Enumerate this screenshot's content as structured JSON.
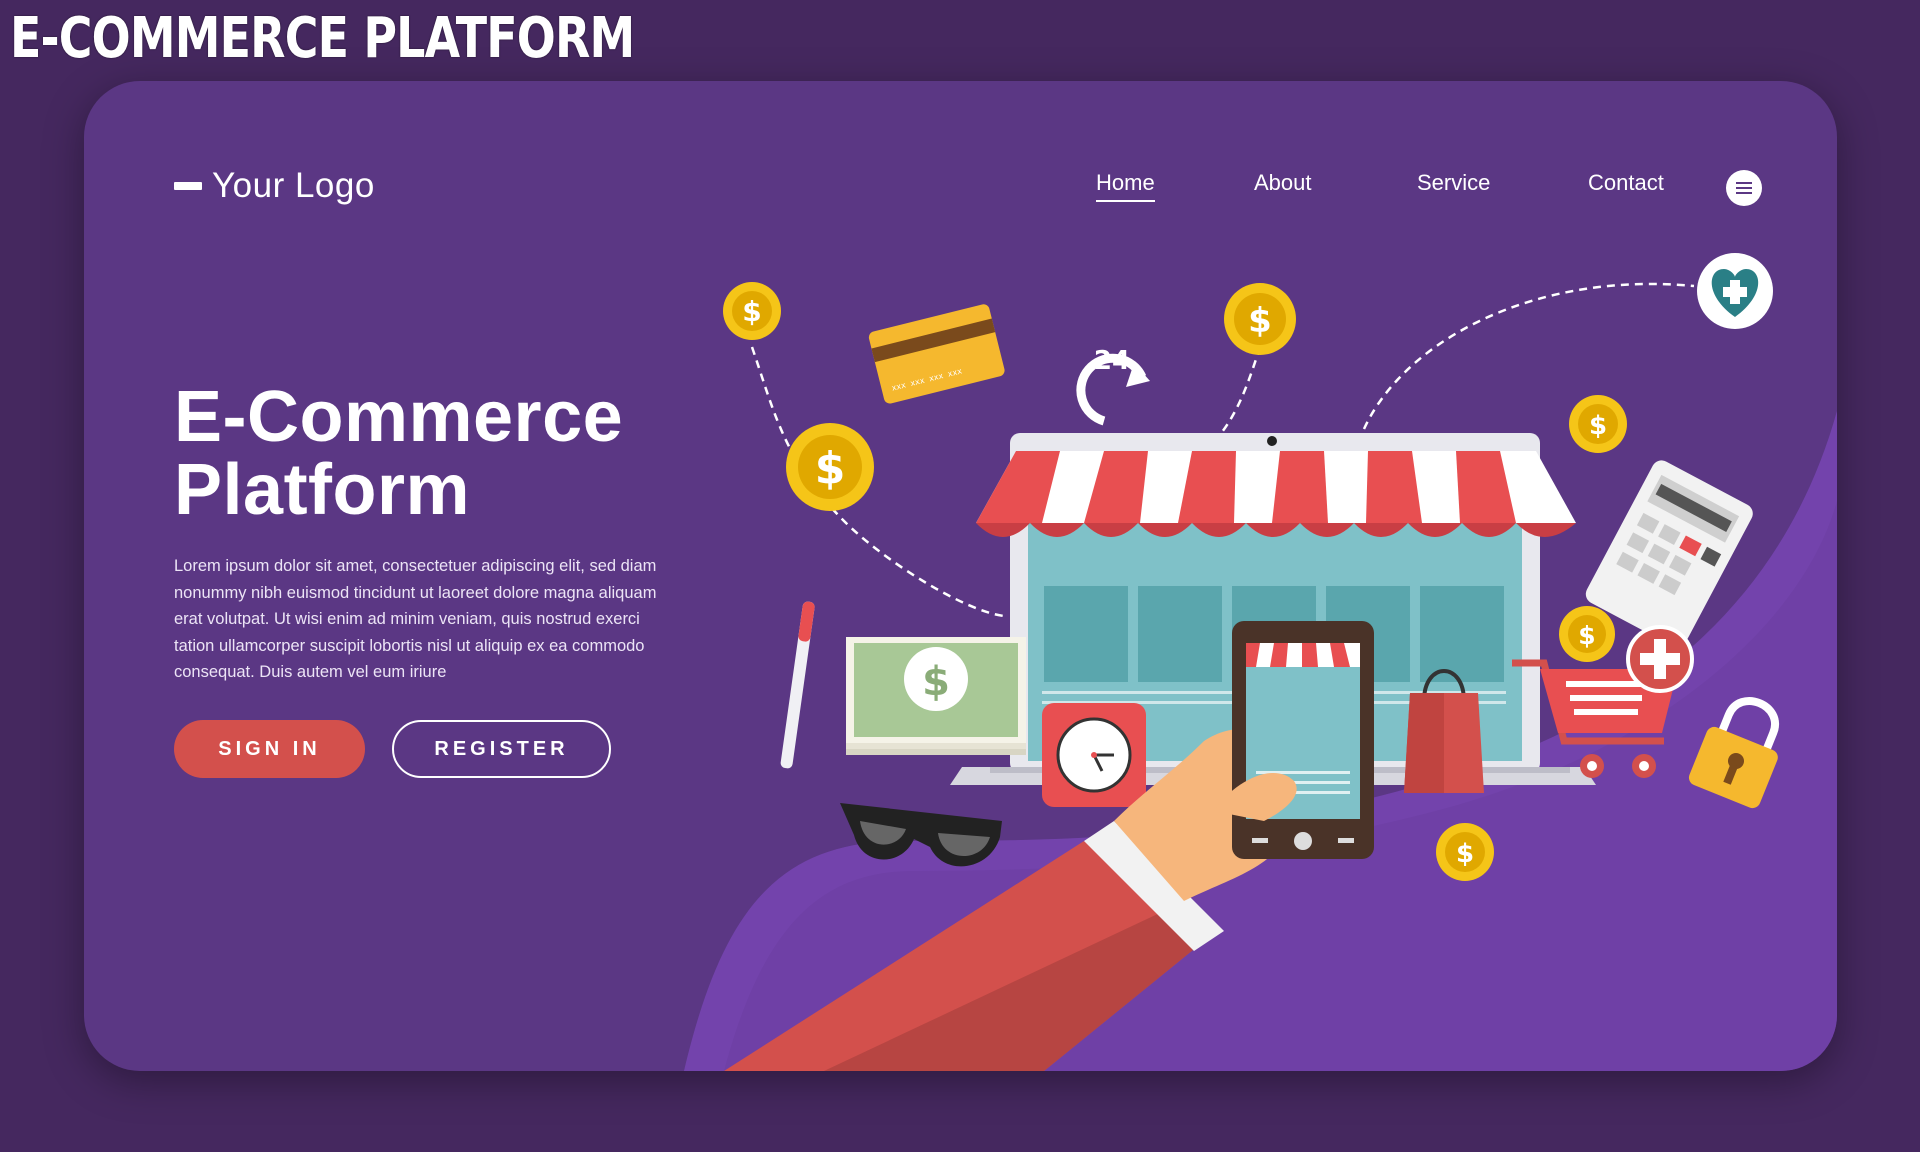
{
  "banner": {
    "title": "E-COMMERCE PLATFORM"
  },
  "header": {
    "logo_text": "Your Logo",
    "nav": [
      {
        "label": "Home",
        "active": true
      },
      {
        "label": "About",
        "active": false
      },
      {
        "label": "Service",
        "active": false
      },
      {
        "label": "Contact",
        "active": false
      }
    ],
    "menu_icon": "hamburger-menu-icon"
  },
  "hero": {
    "title_line1": "E-Commerce",
    "title_line2": "Platform",
    "body": "Lorem ipsum dolor sit amet, consectetuer adipiscing elit, sed diam nonummy nibh euismod tincidunt ut laoreet dolore magna aliquam erat volutpat. Ut wisi enim ad minim veniam, quis nostrud exerci tation ullamcorper suscipit lobortis nisl ut aliquip ex ea commodo consequat. Duis autem vel eum iriure",
    "signin_label": "SIGN IN",
    "register_label": "REGISTER"
  },
  "illustration": {
    "badge_24": "24",
    "coin_symbol": "$",
    "card_number": "xxx xxx xxx xxx",
    "icons": [
      "dollar-coin-icon",
      "credit-card-icon",
      "24-hour-icon",
      "health-shield-icon",
      "storefront-laptop-icon",
      "calculator-icon",
      "shopping-cart-icon",
      "padlock-icon",
      "shopping-bag-icon",
      "smartphone-icon",
      "clock-icon",
      "sunglasses-icon",
      "banknote-icon",
      "pen-icon",
      "hand-icon"
    ]
  },
  "colors": {
    "background": "#45285f",
    "card": "#5b3784",
    "accent": "#d3504c",
    "coin": "#f5c518",
    "awning_red": "#e84f51"
  }
}
